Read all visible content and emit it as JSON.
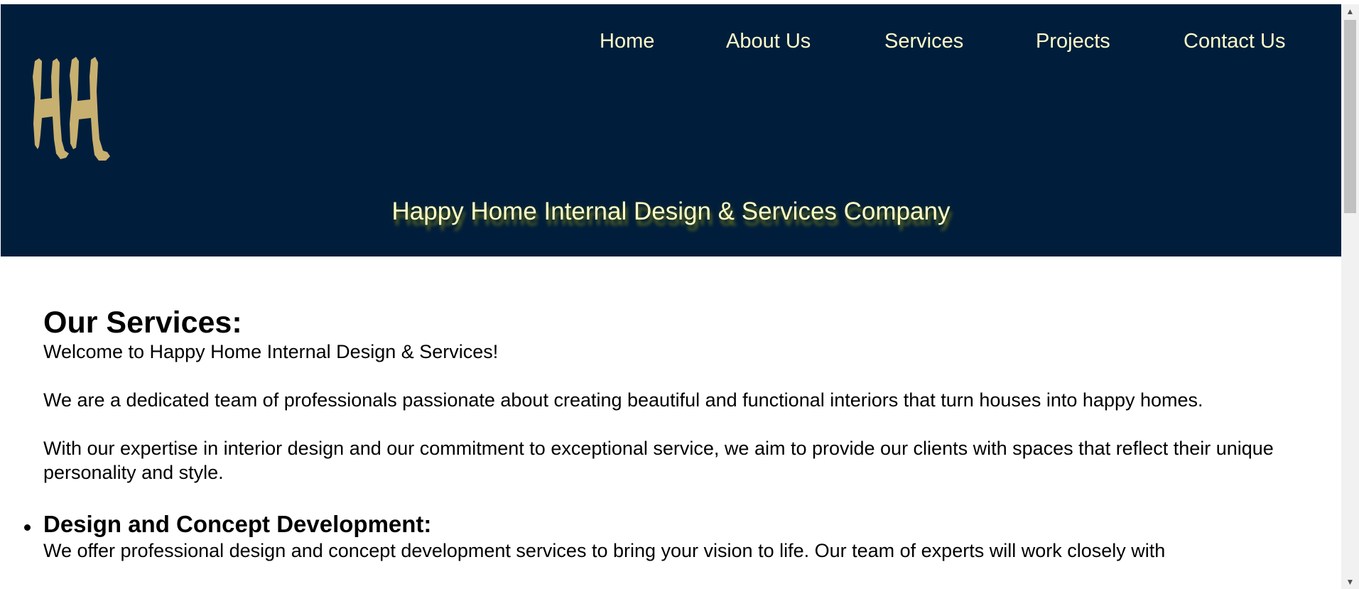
{
  "nav": {
    "items": [
      {
        "label": "Home"
      },
      {
        "label": "About Us"
      },
      {
        "label": "Services"
      },
      {
        "label": "Projects"
      },
      {
        "label": "Contact Us"
      }
    ]
  },
  "header": {
    "logo_text": "HH",
    "tagline": "Happy Home Internal Design & Services Company"
  },
  "main": {
    "title": "Our Services:",
    "paragraphs": [
      "Welcome to Happy Home Internal Design & Services!",
      "We are a dedicated team of professionals passionate about creating beautiful and functional interiors that turn houses into happy homes.",
      "With our expertise in interior design and our commitment to exceptional service, we aim to provide our clients with spaces that reflect their unique personality and style."
    ],
    "services": [
      {
        "heading": "Design and Concept Development:",
        "description": "We offer professional design and concept development services to bring your vision to life. Our team of experts will work closely with"
      }
    ]
  },
  "scrollbar": {
    "up_icon": "triangle-up",
    "down_icon": "triangle-down"
  },
  "colors": {
    "header_bg": "#001e3c",
    "nav_text": "#fffdc8",
    "logo_gold": "#c8b070"
  }
}
